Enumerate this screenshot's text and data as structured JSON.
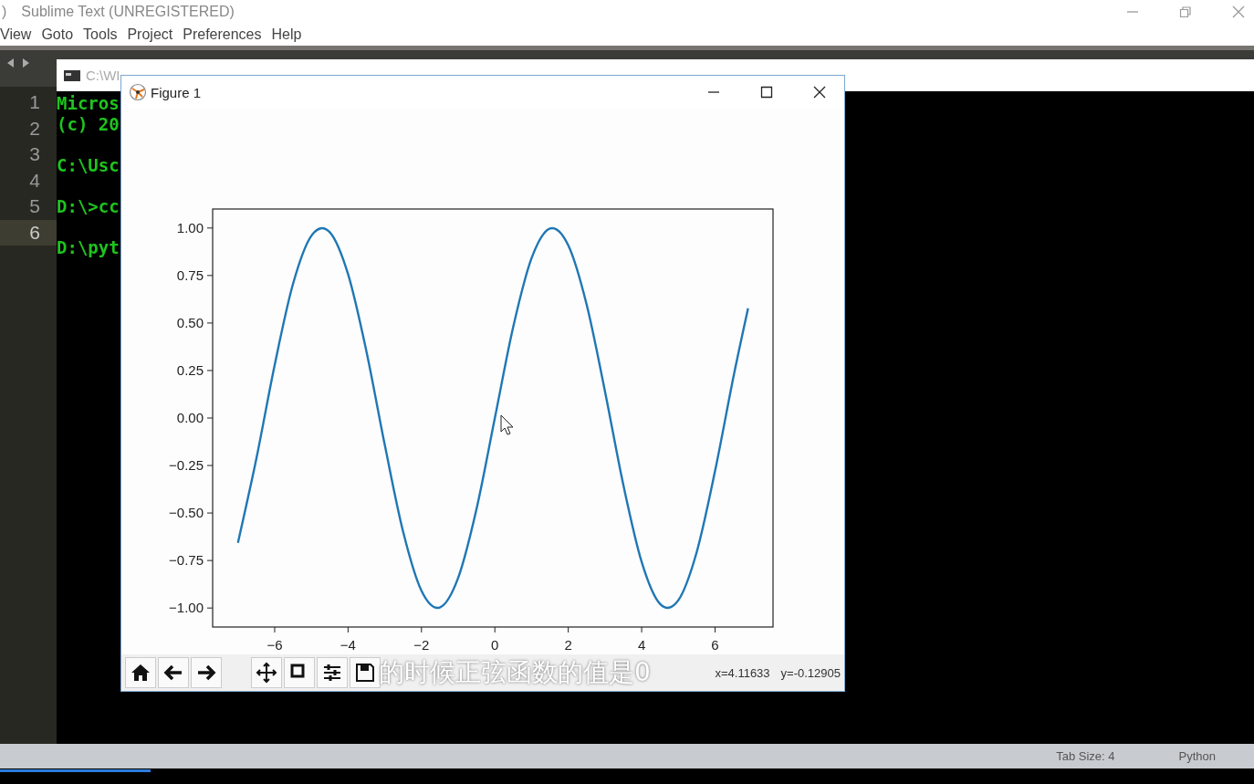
{
  "editor": {
    "title_fragment": ")",
    "title": "Sublime Text (UNREGISTERED)",
    "menu": [
      "View",
      "Goto",
      "Tools",
      "Project",
      "Preferences",
      "Help"
    ],
    "lines": [
      {
        "number": "1",
        "selected": false
      },
      {
        "number": "2",
        "selected": false
      },
      {
        "number": "3",
        "selected": false
      },
      {
        "number": "4",
        "selected": false
      },
      {
        "number": "5",
        "selected": false
      },
      {
        "number": "6",
        "selected": true
      }
    ],
    "status_bar": {
      "tab_size": "Tab Size: 4",
      "syntax": "Python"
    }
  },
  "console": {
    "title": "C:\\WI",
    "blocks": [
      [
        "Micros",
        "(c) 20"
      ],
      [
        "C:\\Usc"
      ],
      [
        "D:\\>cc"
      ],
      [
        "D:\\pyt"
      ]
    ]
  },
  "figure": {
    "title": "Figure 1",
    "chart_data": {
      "type": "line",
      "x": [
        -7,
        -6.5,
        -6,
        -5.5,
        -5,
        -4.5,
        -4,
        -3.5,
        -3,
        -2.5,
        -2,
        -1.5,
        -1,
        -0.5,
        0,
        0.5,
        1,
        1.5,
        2,
        2.5,
        3,
        3.5,
        4,
        4.5,
        5,
        5.5,
        6,
        6.5,
        6.9
      ],
      "series": [
        {
          "color": "#1f77b4",
          "values": [
            -0.657,
            -0.215,
            0.279,
            0.706,
            0.959,
            0.978,
            0.757,
            0.351,
            -0.141,
            -0.598,
            -0.909,
            -0.997,
            -0.841,
            -0.479,
            0,
            0.479,
            0.841,
            0.997,
            0.909,
            0.598,
            0.141,
            -0.351,
            -0.757,
            -0.978,
            -0.959,
            -0.706,
            -0.279,
            0.215,
            0.578
          ]
        }
      ],
      "xlim": [
        -7.69,
        7.58
      ],
      "ylim": [
        -1.1,
        1.1
      ],
      "xticks": [
        {
          "value": -6,
          "label": "−6"
        },
        {
          "value": -4,
          "label": "−4"
        },
        {
          "value": -2,
          "label": "−2"
        },
        {
          "value": 0,
          "label": "0"
        },
        {
          "value": 2,
          "label": "2"
        },
        {
          "value": 4,
          "label": "4"
        },
        {
          "value": 6,
          "label": "6"
        }
      ],
      "yticks": [
        {
          "value": 1,
          "label": "1.00"
        },
        {
          "value": 0.75,
          "label": "0.75"
        },
        {
          "value": 0.5,
          "label": "0.50"
        },
        {
          "value": 0.25,
          "label": "0.25"
        },
        {
          "value": 0,
          "label": "0.00"
        },
        {
          "value": -0.25,
          "label": "−0.25"
        },
        {
          "value": -0.5,
          "label": "−0.50"
        },
        {
          "value": -0.75,
          "label": "−0.75"
        },
        {
          "value": -1,
          "label": "−1.00"
        }
      ]
    },
    "toolbar": [
      {
        "kind": "home"
      },
      {
        "kind": "back"
      },
      {
        "kind": "forward"
      },
      {
        "kind": "pan"
      },
      {
        "kind": "zoom"
      },
      {
        "kind": "configure"
      },
      {
        "kind": "save"
      }
    ],
    "x_readout": "x=4.11633",
    "y_readout": "y=-0.12905"
  },
  "subtitle": "的时候正弦函数的值是0",
  "player": {
    "level": 0.12
  }
}
